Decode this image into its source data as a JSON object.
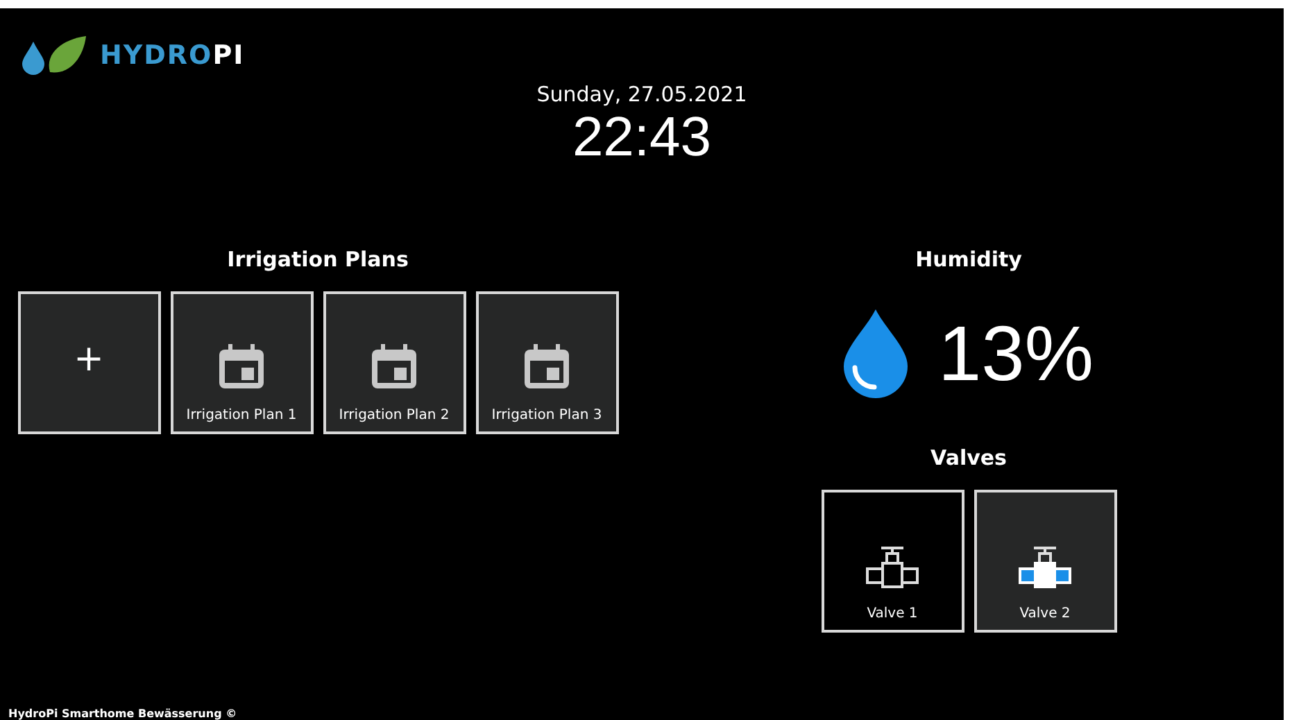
{
  "logo": {
    "text_first": "HYDRO",
    "text_second": "PI"
  },
  "date": "Sunday, 27.05.2021",
  "time": "22:43",
  "irrigation": {
    "title": "Irrigation Plans",
    "add_label": "+",
    "plans": [
      {
        "label": "Irrigation Plan 1"
      },
      {
        "label": "Irrigation Plan 2"
      },
      {
        "label": "Irrigation Plan 3"
      }
    ]
  },
  "humidity": {
    "title": "Humidity",
    "value": "13%"
  },
  "valves": {
    "title": "Valves",
    "items": [
      {
        "label": "Valve 1",
        "on": false
      },
      {
        "label": "Valve 2",
        "on": true
      }
    ]
  },
  "footer": "HydroPi Smarthome Bewässerung ©"
}
